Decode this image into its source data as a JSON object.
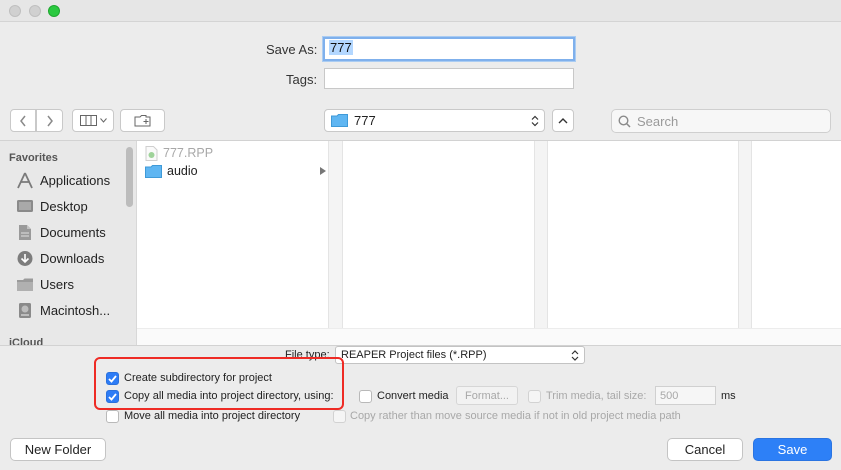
{
  "save_as": {
    "label": "Save As:",
    "value": "777"
  },
  "tags": {
    "label": "Tags:",
    "value": ""
  },
  "toolbar": {
    "location": "777",
    "search_placeholder": "Search"
  },
  "sidebar": {
    "favorites_label": "Favorites",
    "items": [
      {
        "label": "Applications",
        "icon": "applications-icon"
      },
      {
        "label": "Desktop",
        "icon": "desktop-icon"
      },
      {
        "label": "Documents",
        "icon": "documents-icon"
      },
      {
        "label": "Downloads",
        "icon": "downloads-icon"
      },
      {
        "label": "Users",
        "icon": "folder-icon"
      },
      {
        "label": "Macintosh...",
        "icon": "disk-icon"
      }
    ],
    "icloud_label": "iCloud"
  },
  "files": [
    {
      "name": "777.RPP",
      "dimmed": true
    },
    {
      "name": "audio",
      "dimmed": false
    }
  ],
  "options": {
    "file_type_label": "File type:",
    "file_type_value": "REAPER Project files (*.RPP)",
    "create_subdir": {
      "label": "Create subdirectory for project",
      "checked": true
    },
    "copy_media": {
      "label": "Copy all media into project directory, using:",
      "checked": true
    },
    "move_media": {
      "label": "Move all media into project directory",
      "checked": false
    },
    "convert_media": {
      "label": "Convert media",
      "checked": false
    },
    "format_button": "Format...",
    "trim_media": {
      "label": "Trim media, tail size:",
      "checked": false
    },
    "tail_size": "500",
    "tail_unit": "ms",
    "copy_rather": {
      "label": "Copy rather than move source media if not in old project media path",
      "checked": false
    }
  },
  "buttons": {
    "new_folder": "New Folder",
    "cancel": "Cancel",
    "save": "Save"
  },
  "colors": {
    "accent": "#2d80f7",
    "highlight_box": "#ee2b25"
  }
}
